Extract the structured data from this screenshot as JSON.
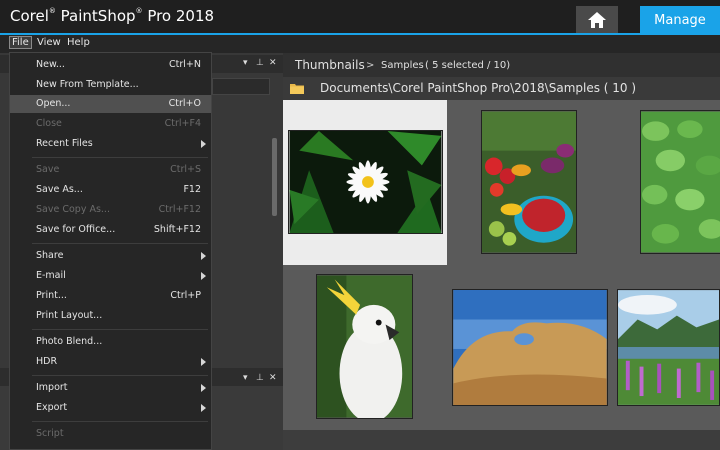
{
  "app": {
    "title": "Corel",
    "title_mark": "®",
    "title_rest": "PaintShop",
    "title_mark2": "®",
    "title_end": "Pro 2018"
  },
  "header": {
    "manage_label": "Manage",
    "home_icon": "home-icon"
  },
  "menubar": {
    "file": "File",
    "view": "View",
    "help": "Help"
  },
  "breadcrumb": {
    "section": "Thumbnails",
    "separator": ">",
    "folder": "Samples",
    "selection": "( 5 selected / 10)"
  },
  "path": {
    "text": "Documents\\Corel PaintShop Pro\\2018\\Samples ( 10 )"
  },
  "panel_controls": {
    "dropdown": "▾",
    "pin": "⊥",
    "close": "✕"
  },
  "file_menu": {
    "new": {
      "label": "New...",
      "shortcut": "Ctrl+N"
    },
    "new_template": {
      "label": "New From Template..."
    },
    "open": {
      "label": "Open...",
      "shortcut": "Ctrl+O"
    },
    "close": {
      "label": "Close",
      "shortcut": "Ctrl+F4"
    },
    "recent": {
      "label": "Recent Files"
    },
    "save": {
      "label": "Save",
      "shortcut": "Ctrl+S"
    },
    "save_as": {
      "label": "Save As...",
      "shortcut": "F12"
    },
    "save_copy": {
      "label": "Save Copy As...",
      "shortcut": "Ctrl+F12"
    },
    "save_office": {
      "label": "Save for Office...",
      "shortcut": "Shift+F12"
    },
    "share": {
      "label": "Share"
    },
    "email": {
      "label": "E-mail"
    },
    "print": {
      "label": "Print...",
      "shortcut": "Ctrl+P"
    },
    "print_layout": {
      "label": "Print Layout..."
    },
    "photo_blend": {
      "label": "Photo Blend..."
    },
    "hdr": {
      "label": "HDR"
    },
    "import": {
      "label": "Import"
    },
    "export": {
      "label": "Export"
    },
    "script": {
      "label": "Script"
    }
  },
  "colors": {
    "accent": "#1aa3e8",
    "selected_cell": "#ececec",
    "menu_highlight": "#505050"
  }
}
